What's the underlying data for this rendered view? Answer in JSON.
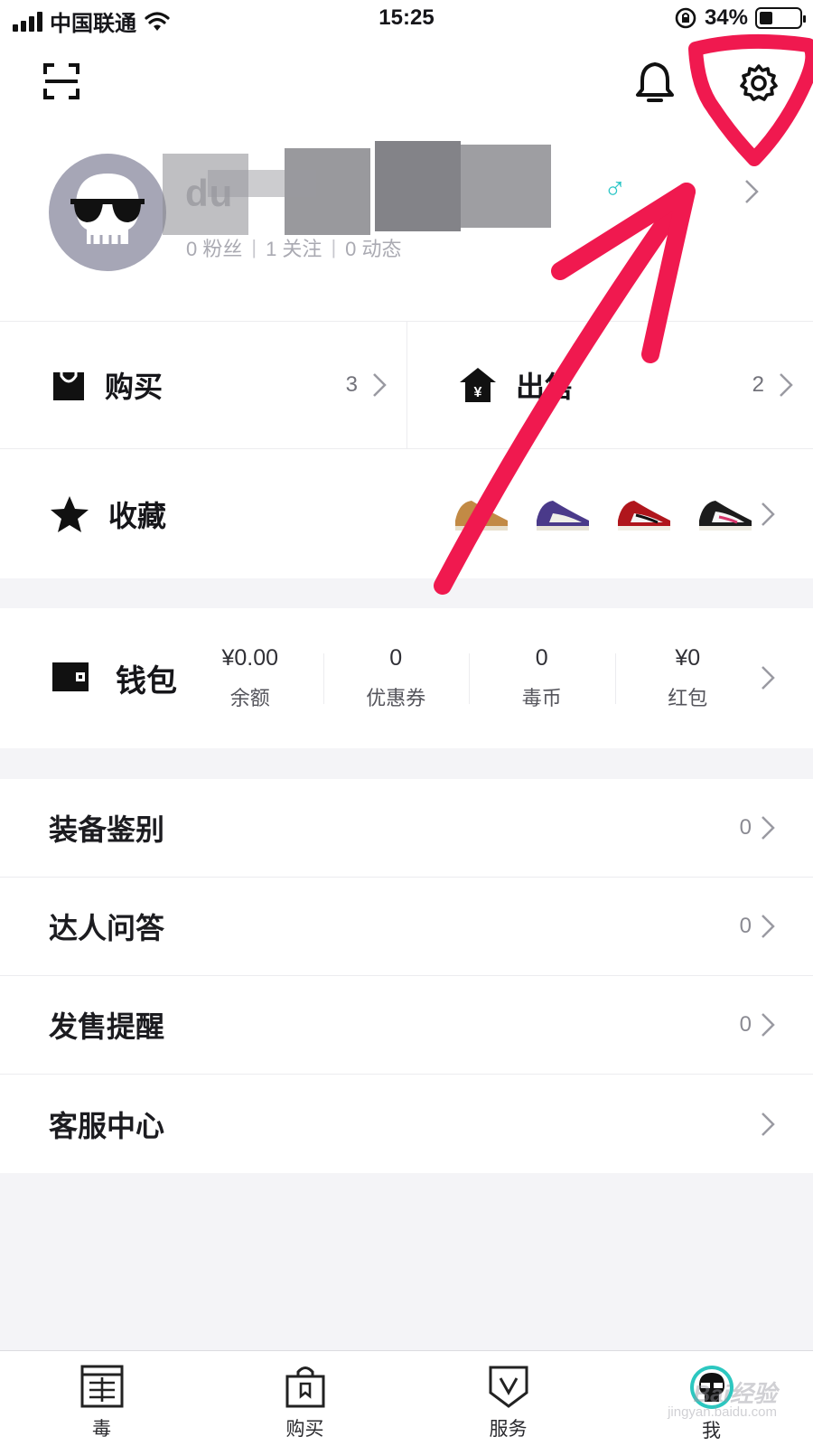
{
  "status_bar": {
    "carrier": "中国联通",
    "time": "15:25",
    "battery": "34%",
    "battery_level": 0.34
  },
  "header": {
    "scan_icon": "scan-icon",
    "bell_icon": "bell-icon",
    "settings_icon": "gear-icon"
  },
  "profile": {
    "username": "du",
    "gender_symbol": "♂",
    "fans": "0 粉丝",
    "follows": "1 关注",
    "posts": "0 动态",
    "separator": "|"
  },
  "cards": {
    "buy": {
      "label": "购买",
      "count": "3"
    },
    "sell": {
      "label": "出售",
      "count": "2"
    }
  },
  "favorites": {
    "label": "收藏"
  },
  "wallet": {
    "label": "钱包",
    "items": [
      {
        "value": "¥0.00",
        "label": "余额"
      },
      {
        "value": "0",
        "label": "优惠券"
      },
      {
        "value": "0",
        "label": "毒币"
      },
      {
        "value": "¥0",
        "label": "红包"
      }
    ]
  },
  "menu": [
    {
      "label": "装备鉴别",
      "count": "0"
    },
    {
      "label": "达人问答",
      "count": "0"
    },
    {
      "label": "发售提醒",
      "count": "0"
    },
    {
      "label": "客服中心",
      "count": ""
    }
  ],
  "tabs": [
    {
      "label": "毒",
      "icon": "newspaper-icon"
    },
    {
      "label": "购买",
      "icon": "shopping-bag-icon"
    },
    {
      "label": "服务",
      "icon": "shield-v-icon"
    },
    {
      "label": "我",
      "icon": "avatar-icon"
    }
  ],
  "watermark": {
    "text": "Bai经验",
    "sub": "jingyan.baidu.com"
  },
  "colors": {
    "annotation": "#f0194f",
    "accent_gender": "#2bc6c6",
    "band": "#f4f4f7"
  }
}
